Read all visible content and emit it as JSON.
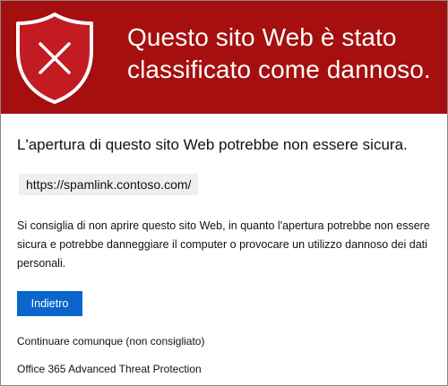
{
  "colors": {
    "banner": "#a50f0f",
    "shield_fill": "#c21b22",
    "shield_outline": "#ffffff",
    "button": "#0a66cc",
    "url_box": "#efefef"
  },
  "banner": {
    "icon": "shield-x-icon",
    "title": "Questo sito Web è stato classificato come dannoso."
  },
  "main": {
    "heading": "L'apertura di questo sito Web potrebbe non essere sicura.",
    "url": "https://spamlink.contoso.com/",
    "warning": "Si consiglia di non aprire questo sito Web, in quanto l'apertura potrebbe non essere sicura e potrebbe danneggiare il computer o provocare un utilizzo dannoso dei dati personali.",
    "back_button_label": "Indietro",
    "continue_link": "Continuare comunque (non consigliato)",
    "footer": "Office 365 Advanced Threat Protection"
  }
}
